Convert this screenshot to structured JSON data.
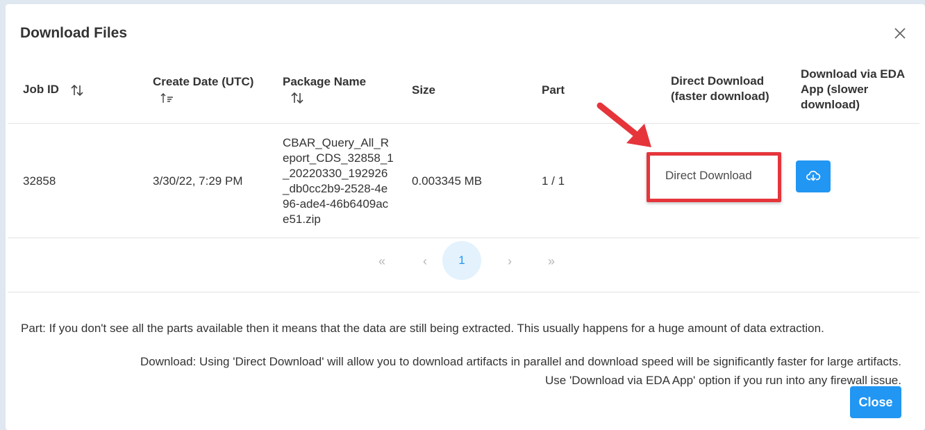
{
  "dialog": {
    "title": "Download Files",
    "close_icon": "close-icon"
  },
  "table": {
    "headers": {
      "job_id": "Job ID",
      "create_date": "Create Date (UTC)",
      "package_name": "Package Name",
      "size": "Size",
      "part": "Part",
      "direct_download_line1": "Direct Download",
      "direct_download_line2": "(faster download)",
      "eda_line1": "Download via EDA",
      "eda_line2": "App (slower",
      "eda_line3": "download)"
    },
    "rows": [
      {
        "job_id": "32858",
        "create_date": "3/30/22, 7:29 PM",
        "package_name": "CBAR_Query_All_Report_CDS_32858_1_20220330_192926_db0cc2b9-2528-4e96-ade4-46b6409ace51.zip",
        "size": "0.003345 MB",
        "part": "1 / 1",
        "direct_download": "Direct Download",
        "eda_icon": "cloud-download-icon"
      }
    ]
  },
  "pagination": {
    "first": "«",
    "prev": "‹",
    "current": "1",
    "next": "›",
    "last": "»"
  },
  "notes": {
    "part_note": "Part: If you don't see all the parts available then it means that the data are still being extracted. This usually happens for a huge amount of data extraction.",
    "download_note_line1": "Download: Using 'Direct Download' will allow you to download artifacts in parallel and download speed will be significantly faster for large artifacts.",
    "download_note_line2": "Use 'Download via EDA App' option if you run into any firewall issue."
  },
  "footer": {
    "close_label": "Close"
  },
  "colors": {
    "accent": "#2196f3",
    "highlight": "#e5353b",
    "backdrop": "#dfe7f0"
  }
}
